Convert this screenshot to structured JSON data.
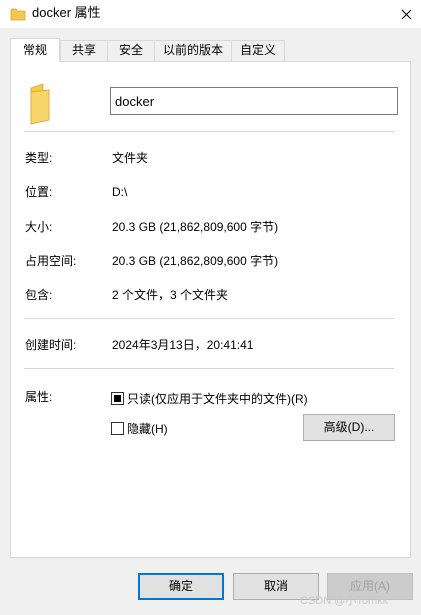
{
  "window": {
    "title": "docker 属性",
    "close_label": "✕"
  },
  "tabs": [
    "常规",
    "共享",
    "安全",
    "以前的版本",
    "自定义"
  ],
  "general": {
    "folder_name": "docker",
    "rows": [
      {
        "label": "类型:",
        "value": "文件夹"
      },
      {
        "label": "位置:",
        "value": "D:\\"
      },
      {
        "label": "大小:",
        "value": "20.3 GB (21,862,809,600 字节)"
      },
      {
        "label": "占用空间:",
        "value": "20.3 GB (21,862,809,600 字节)"
      },
      {
        "label": "包含:",
        "value": "2 个文件，3 个文件夹"
      },
      {
        "label": "创建时间:",
        "value": "2024年3月13日，20:41:41"
      }
    ],
    "attributes_label": "属性:",
    "readonly_label": "只读(仅应用于文件夹中的文件)(R)",
    "hidden_label": "隐藏(H)",
    "advanced_label": "高级(D)..."
  },
  "footer": {
    "ok": "确定",
    "cancel": "取消",
    "apply": "应用(A)"
  },
  "watermark": "CSDN @小Tomkk",
  "colors": {
    "accent": "#0078d7",
    "folder": "#f3c74f"
  }
}
